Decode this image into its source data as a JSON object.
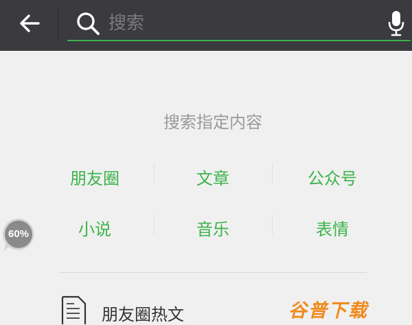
{
  "search": {
    "placeholder": "搜索"
  },
  "hint": "搜索指定内容",
  "categories": [
    {
      "label": "朋友圈"
    },
    {
      "label": "文章"
    },
    {
      "label": "公众号"
    },
    {
      "label": "小说"
    },
    {
      "label": "音乐"
    },
    {
      "label": "表情"
    }
  ],
  "hot": {
    "label": "朋友圈热文"
  },
  "badge": {
    "value": "60%"
  },
  "watermark": "谷普下载",
  "colors": {
    "topbar": "#3a3a3f",
    "accent": "#3bb34a",
    "background": "#f0f0f0",
    "watermark": "#f08a1c"
  },
  "icons": {
    "back": "arrow-left-icon",
    "search": "magnifier-icon",
    "mic": "microphone-icon",
    "hot": "document-icon"
  }
}
